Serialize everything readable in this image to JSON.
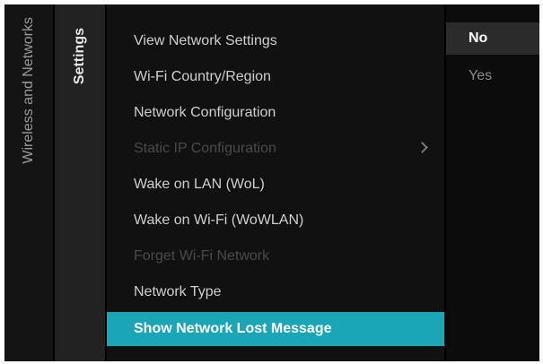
{
  "breadcrumb": {
    "level1": "Wireless and Networks",
    "level2": "Settings"
  },
  "menu": {
    "items": [
      {
        "label": "View Network Settings"
      },
      {
        "label": "Wi-Fi Country/Region"
      },
      {
        "label": "Network Configuration"
      },
      {
        "label": "Static IP Configuration"
      },
      {
        "label": "Wake on LAN (WoL)"
      },
      {
        "label": "Wake on Wi-Fi (WoWLAN)"
      },
      {
        "label": "Forget Wi-Fi Network"
      },
      {
        "label": "Network Type"
      },
      {
        "label": "Show Network Lost Message"
      }
    ]
  },
  "options": {
    "items": [
      {
        "label": "No"
      },
      {
        "label": "Yes"
      }
    ]
  },
  "colors": {
    "accent": "#1aa6b7",
    "background": "#000000"
  },
  "icons": {
    "submenu": "chevron-right-icon"
  }
}
